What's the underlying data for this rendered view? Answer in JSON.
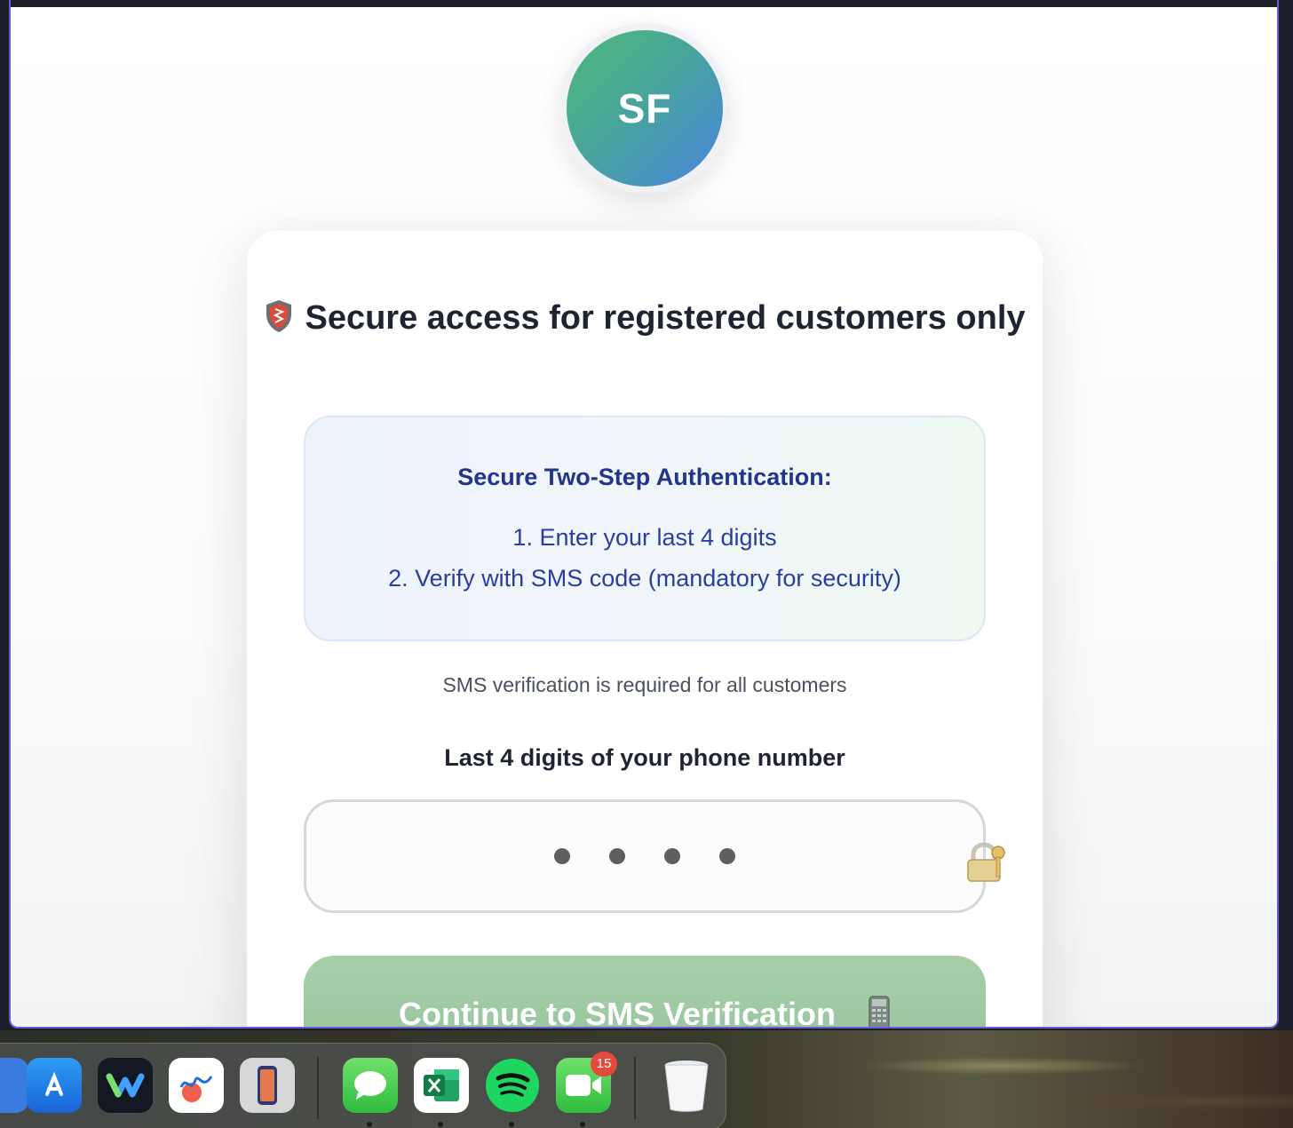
{
  "avatar": {
    "initials": "SF"
  },
  "card": {
    "title": "Secure access for registered customers only",
    "title_icon": "shield-icon",
    "info": {
      "heading": "Secure Two-Step Authentication:",
      "steps": [
        "1. Enter your last 4 digits",
        "2. Verify with SMS code (mandatory for security)"
      ]
    },
    "note": "SMS verification is required for all customers",
    "field_label": "Last 4 digits of your phone number",
    "pin_value": "••••",
    "pin_icon": "lock-key-icon",
    "continue_label": "Continue to SMS Verification",
    "continue_icon": "phone-icon"
  },
  "dock": {
    "apps": [
      "Finder",
      "App Store",
      "Webex",
      "Freeform",
      "iPhone Mirroring",
      "Messages",
      "Microsoft Excel",
      "Spotify",
      "FaceTime",
      "Trash"
    ],
    "facetime_badge": "15"
  },
  "colors": {
    "accent_blue": "#23348c",
    "button_green": "#94c39a",
    "avatar_gradient_start": "#4fba78",
    "avatar_gradient_end": "#4a86e0",
    "window_border": "#6b5bd6"
  }
}
